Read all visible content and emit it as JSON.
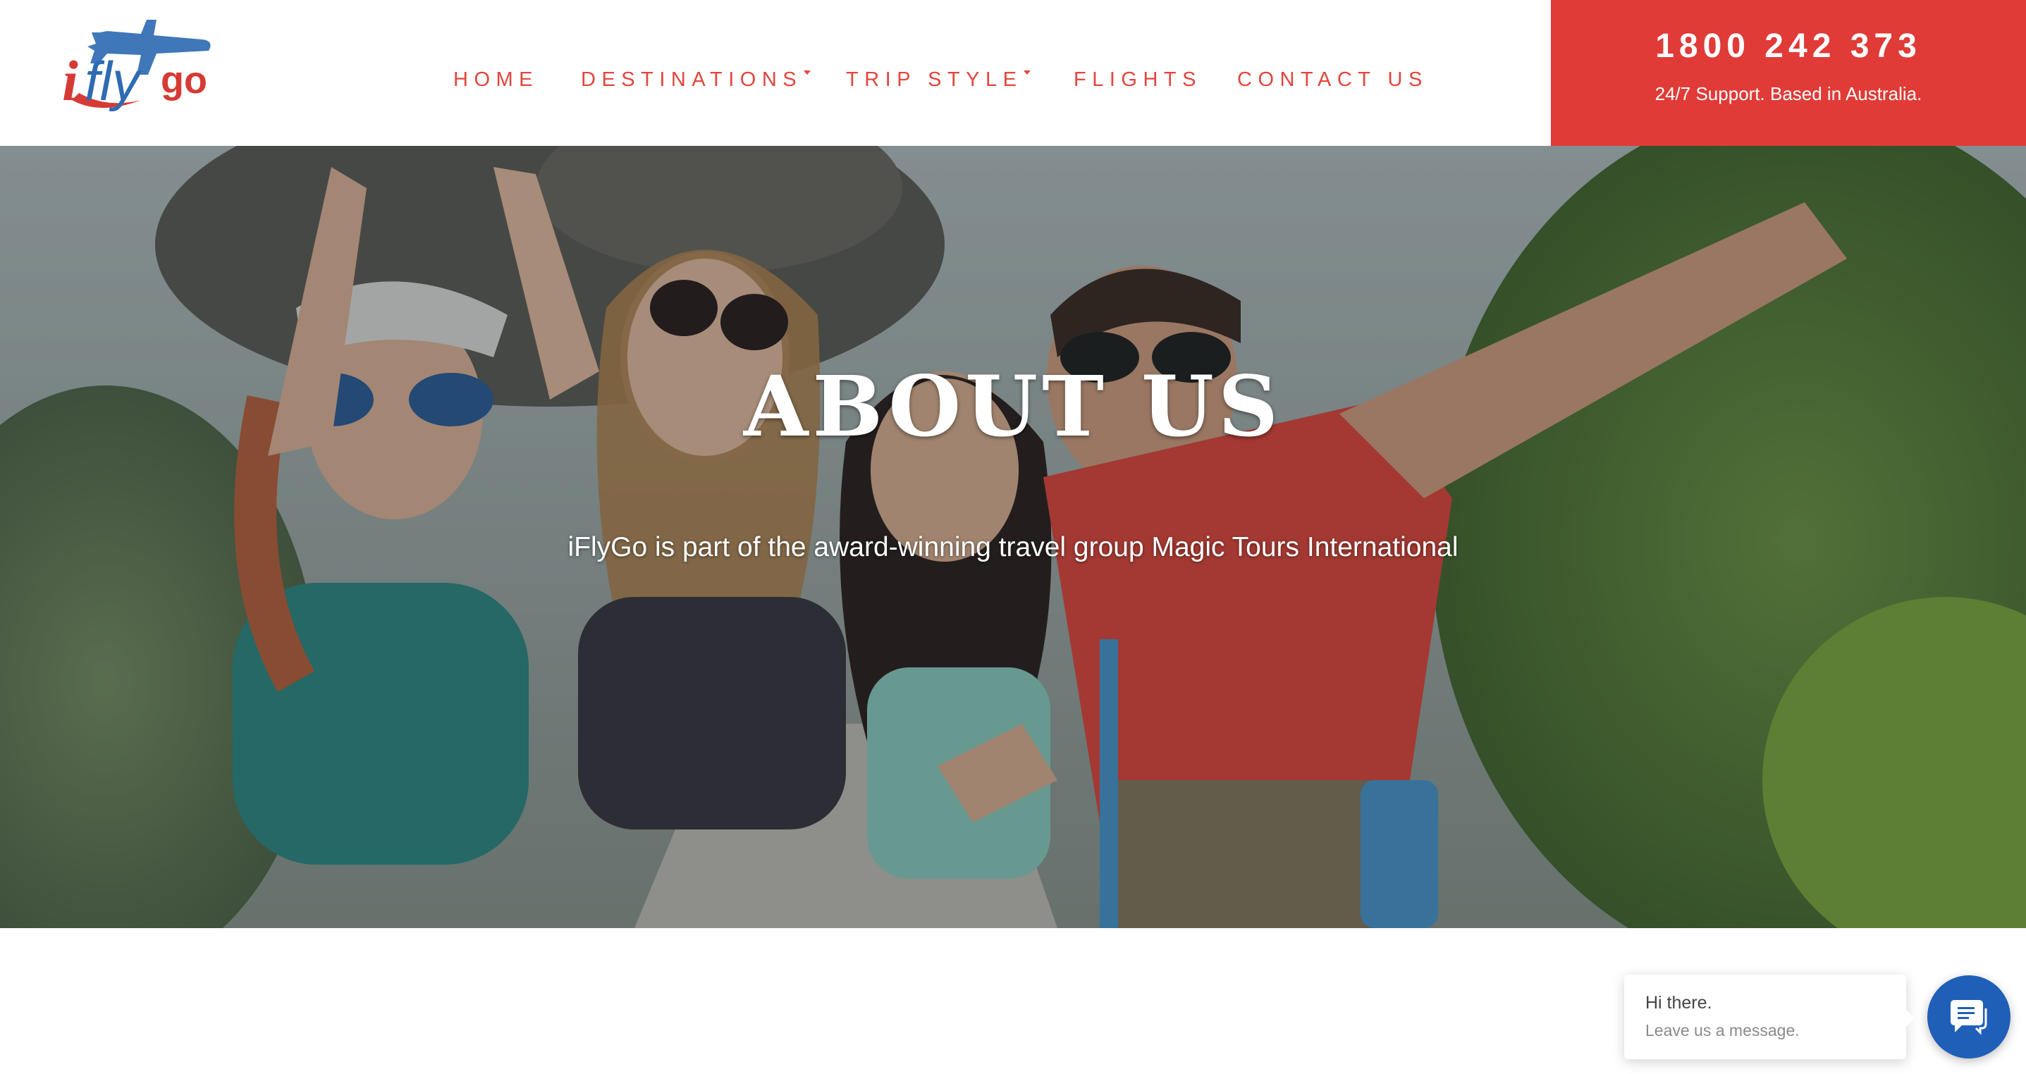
{
  "brand": {
    "logo_alt": "iflygo",
    "logo_letters": [
      "i",
      "fly",
      "go"
    ]
  },
  "nav": {
    "items": [
      {
        "label": "HOME",
        "has_dropdown": false
      },
      {
        "label": "DESTINATIONS",
        "has_dropdown": true
      },
      {
        "label": "TRIP STYLE",
        "has_dropdown": true
      },
      {
        "label": "FLIGHTS",
        "has_dropdown": false
      },
      {
        "label": "CONTACT US",
        "has_dropdown": false
      }
    ]
  },
  "contact": {
    "phone": "1800 242 373",
    "support_text": "24/7 Support.  Based in Australia."
  },
  "hero": {
    "title": "ABOUT US",
    "subtitle": "iFlyGo is part of the award-winning travel group Magic Tours International"
  },
  "chat": {
    "greeting": "Hi there.",
    "prompt": "Leave us a message.",
    "icon": "chat-icon"
  },
  "colors": {
    "accent_red": "#e2463d",
    "phone_box_bg": "#e03b37",
    "logo_blue": "#2f6bb3",
    "chat_button_blue": "#1f5fb8"
  }
}
